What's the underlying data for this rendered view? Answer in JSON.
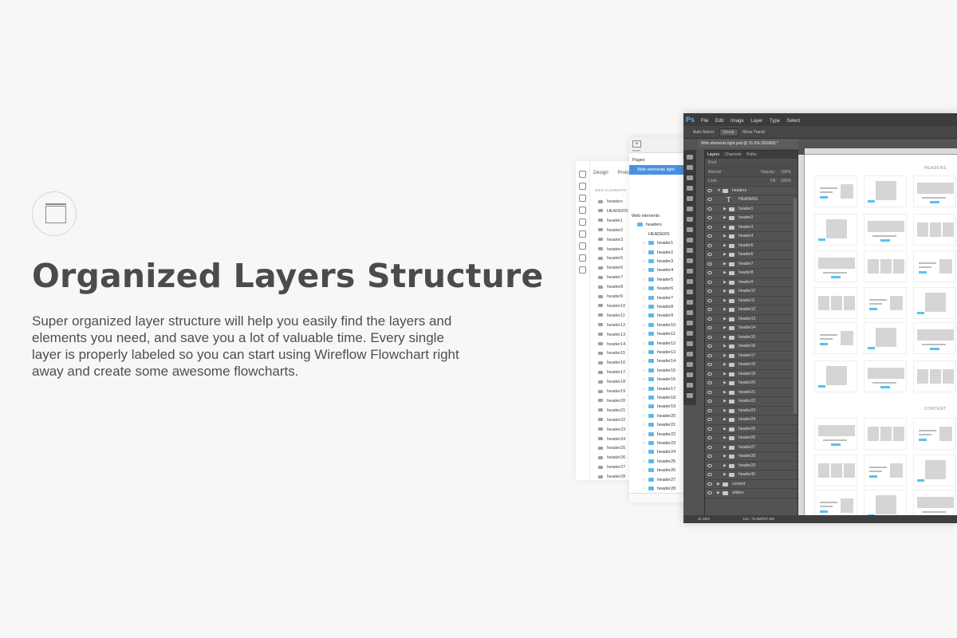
{
  "hero": {
    "icon": "layers-icon",
    "title": "Organized Layers Structure",
    "description": "Super organized layer structure will help you easily find the layers and elements you need, and save you a lot of valuable time. Every single layer is properly labeled so you can start using Wireflow Flowchart right away and create some awesome flowcharts."
  },
  "sketch": {
    "tabs": [
      "Design",
      "Prototyping"
    ],
    "section": "WEB ELEMENTS",
    "rows": [
      "headers",
      "HEADERS",
      "header1",
      "header2",
      "header3",
      "header4",
      "header5",
      "header6",
      "header7",
      "header8",
      "header9",
      "header10",
      "header11",
      "header12",
      "header13",
      "header14",
      "header15",
      "header16",
      "header17",
      "header18",
      "header19",
      "header20",
      "header21",
      "header22",
      "header23",
      "header24",
      "header25",
      "header26",
      "header27",
      "header28"
    ]
  },
  "mid_panel": {
    "insert_label": "Insert",
    "pages_label": "Pages",
    "selected_page": "Web elements light",
    "page_name": "Web elements light",
    "items": [
      "Web elements",
      "headers",
      "HEADERS",
      "header1",
      "header2",
      "header3",
      "header4",
      "header5",
      "header6",
      "header7",
      "header8",
      "header9",
      "header10",
      "header11",
      "header12",
      "header13",
      "header14",
      "header15",
      "header16",
      "header17",
      "header18",
      "header19",
      "header20",
      "header21",
      "header22",
      "header23",
      "header24",
      "header25",
      "header26",
      "header27",
      "header28"
    ]
  },
  "photoshop": {
    "logo": "Ps",
    "menu": [
      "File",
      "Edit",
      "Image",
      "Layer",
      "Type",
      "Select"
    ],
    "options": {
      "auto_select": "Auto-Select:",
      "group": "Group",
      "show_transform": "Show Transf."
    },
    "doc_tab": "Web elements light.psd @ 31.6% (RGB/8) *",
    "layer_tabs": [
      "Layers",
      "Channels",
      "Paths"
    ],
    "kind": "Kind",
    "blend": "Normal",
    "opacity_label": "Opacity:",
    "opacity": "100%",
    "lock_label": "Lock:",
    "fill_label": "Fill:",
    "fill": "100%",
    "group_name": "headers",
    "text_layer": "HEADERS",
    "layers": [
      "header1",
      "header2",
      "header3",
      "header4",
      "header5",
      "header6",
      "header7",
      "header8",
      "header9",
      "header10",
      "header11",
      "header12",
      "header13",
      "header14",
      "header15",
      "header16",
      "header17",
      "header18",
      "header19",
      "header20",
      "header21",
      "header22",
      "header23",
      "header24",
      "header25",
      "header26",
      "header27",
      "header28",
      "header29",
      "header30"
    ],
    "trailing_groups": [
      "content",
      "sliders"
    ],
    "zoom": "31.59%",
    "doc_info": "Doc: 75.9M/257.0M",
    "canvas_sections": [
      "HEADERS",
      "CONTENT"
    ],
    "accent": "#56c2f2"
  }
}
